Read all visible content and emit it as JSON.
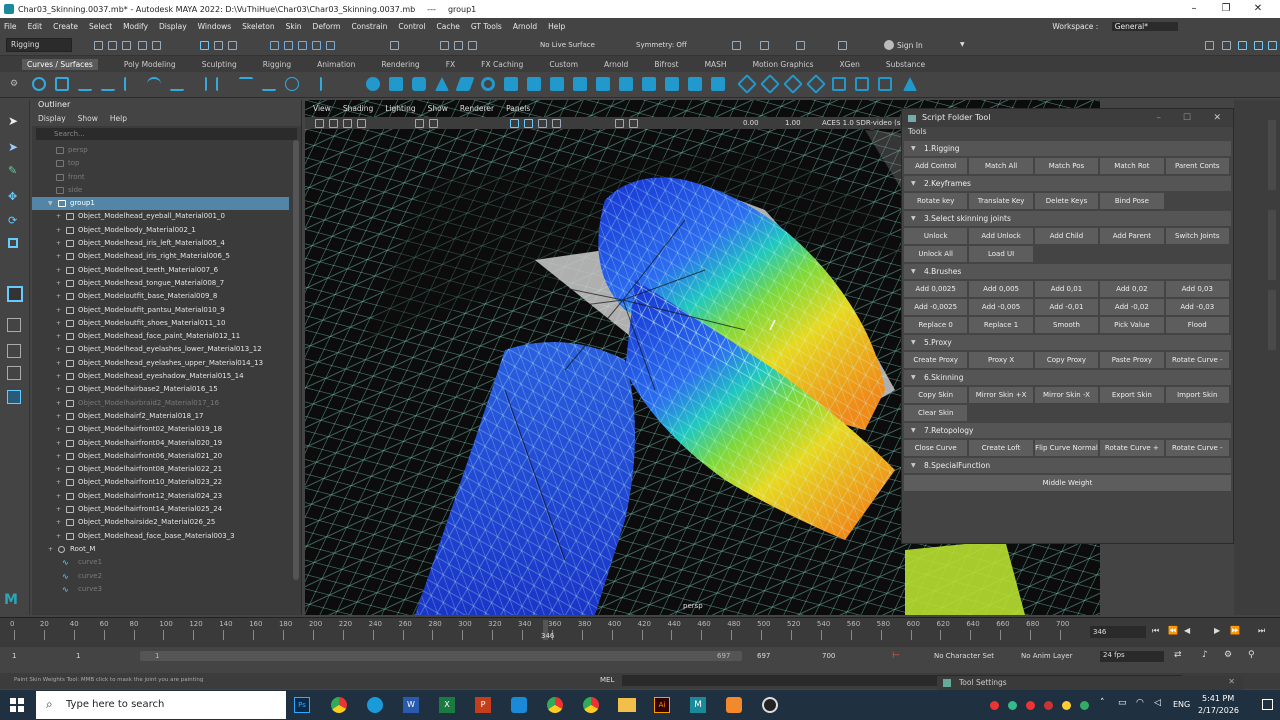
{
  "window": {
    "title": "Char03_Skinning.0037.mb* - Autodesk MAYA 2022: D:\\VuThiHue\\Char03\\Char03_Skinning.0037.mb",
    "separator": "---",
    "selection": "group1"
  },
  "menubar": {
    "items": [
      "File",
      "Edit",
      "Create",
      "Select",
      "Modify",
      "Display",
      "Windows",
      "Skeleton",
      "Skin",
      "Deform",
      "Constrain",
      "Control",
      "Cache",
      "GT Tools",
      "Arnold",
      "Help"
    ],
    "workspace_label": "Workspace :",
    "workspace_value": "General*"
  },
  "statusline": {
    "mode": "Rigging",
    "live_surface": "No Live Surface",
    "symmetry": "Symmetry: Off",
    "sign_in": "Sign In"
  },
  "shelf": {
    "tabs": [
      "Curves / Surfaces",
      "Poly Modeling",
      "Sculpting",
      "Rigging",
      "Animation",
      "Rendering",
      "FX",
      "FX Caching",
      "Custom",
      "Arnold",
      "Bifrost",
      "MASH",
      "Motion Graphics",
      "XGen",
      "Substance"
    ],
    "active_tab": "Curves / Surfaces"
  },
  "outliner": {
    "title": "Outliner",
    "menu": [
      "Display",
      "Show",
      "Help"
    ],
    "search_placeholder": "Search...",
    "cameras": [
      "persp",
      "top",
      "front",
      "side"
    ],
    "group": "group1",
    "objects": [
      "Object_Modelhead_eyeball_Material001_0",
      "Object_Modelbody_Material002_1",
      "Object_Modelhead_iris_left_Material005_4",
      "Object_Modelhead_iris_right_Material006_5",
      "Object_Modelhead_teeth_Material007_6",
      "Object_Modelhead_tongue_Material008_7",
      "Object_Modeloutfit_base_Material009_8",
      "Object_Modeloutfit_pantsu_Material010_9",
      "Object_Modeloutfit_shoes_Material011_10",
      "Object_Modelhead_face_paint_Material012_11",
      "Object_Modelhead_eyelashes_lower_Material013_12",
      "Object_Modelhead_eyelashes_upper_Material014_13",
      "Object_Modelhead_eyeshadow_Material015_14",
      "Object_Modelhairbase2_Material016_15",
      "Object_Modelhairbraid2_Material017_16",
      "Object_Modelhairf2_Material018_17",
      "Object_Modelhairfront02_Material019_18",
      "Object_Modelhairfront04_Material020_19",
      "Object_Modelhairfront06_Material021_20",
      "Object_Modelhairfront08_Material022_21",
      "Object_Modelhairfront10_Material023_22",
      "Object_Modelhairfront12_Material024_23",
      "Object_Modelhairfront14_Material025_24",
      "Object_Modelhairside2_Material026_25",
      "Object_Modelhead_face_base_Material003_3"
    ],
    "root": "Root_M",
    "curves": [
      "curve1",
      "curve2",
      "curve3"
    ]
  },
  "viewport": {
    "menu": [
      "View",
      "Shading",
      "Lighting",
      "Show",
      "Renderer",
      "Panels"
    ],
    "exposure": "0.00",
    "gamma": "1.00",
    "colorspace": "ACES 1.0 SDR-video (s",
    "camera_label": "persp"
  },
  "script_tool": {
    "title": "Script Folder Tool",
    "menu": "Tools",
    "sections": [
      {
        "title": "1.Rigging",
        "rows": [
          [
            "Add Control",
            "Match All",
            "Match Pos",
            "Match Rot",
            "Parent Conts"
          ]
        ]
      },
      {
        "title": "2.Keyframes",
        "rows": [
          [
            "Rotate key",
            "Translate Key",
            "Delete Keys",
            "Bind Pose"
          ]
        ]
      },
      {
        "title": "3.Select skinning joints",
        "rows": [
          [
            "Unlock",
            "Add Unlock",
            "Add Child",
            "Add Parent",
            "Switch Joints"
          ],
          [
            "Unlock All",
            "Load UI"
          ]
        ]
      },
      {
        "title": "4.Brushes",
        "rows": [
          [
            "Add 0,0025",
            "Add 0,005",
            "Add 0,01",
            "Add 0,02",
            "Add 0,03"
          ],
          [
            "Add -0,0025",
            "Add -0,005",
            "Add -0,01",
            "Add -0,02",
            "Add -0,03"
          ],
          [
            "Replace 0",
            "Replace 1",
            "Smooth",
            "Pick Value",
            "Flood"
          ]
        ]
      },
      {
        "title": "5.Proxy",
        "rows": [
          [
            "Create Proxy",
            "Proxy X",
            "Copy Proxy",
            "Paste Proxy",
            "Rotate Curve -"
          ]
        ]
      },
      {
        "title": "6.Skinning",
        "rows": [
          [
            "Copy Skin",
            "Mirror Skin +X",
            "Mirror Skin -X",
            "Export Skin",
            "Import Skin"
          ],
          [
            "Clear Skin"
          ]
        ]
      },
      {
        "title": "7.Retopology",
        "rows": [
          [
            "Close Curve",
            "Create Loft",
            "Flip Curve Normal",
            "Rotate Curve +",
            "Rotate Curve -"
          ]
        ]
      },
      {
        "title": "8.SpecialFunction",
        "rows": [
          [
            "Middle Weight"
          ]
        ]
      }
    ]
  },
  "timeline": {
    "ticks": [
      "0",
      "20",
      "40",
      "60",
      "80",
      "100",
      "120",
      "140",
      "160",
      "180",
      "200",
      "220",
      "240",
      "260",
      "280",
      "300",
      "320",
      "340",
      "360",
      "380",
      "400",
      "420",
      "440",
      "460",
      "480",
      "500",
      "520",
      "540",
      "560",
      "580",
      "600",
      "620",
      "640",
      "660",
      "680",
      "700"
    ],
    "current_frame": "346",
    "frame_field": "346"
  },
  "range": {
    "start": "1",
    "inner_start": "1",
    "playback_start": "1",
    "end_value": "697",
    "end_field": "697",
    "anim_end": "700",
    "character_set": "No Character Set",
    "anim_layer": "No Anim Layer",
    "fps": "24 fps"
  },
  "cmdline": {
    "help_text": "Paint Skin Weights Tool: MMB click to mask the joint you are painting",
    "lang": "MEL"
  },
  "tool_settings": {
    "title": "Tool Settings"
  },
  "taskbar": {
    "search_placeholder": "Type here to search",
    "time": "5:41 PM",
    "date": "2/17/2026",
    "lang": "ENG"
  }
}
